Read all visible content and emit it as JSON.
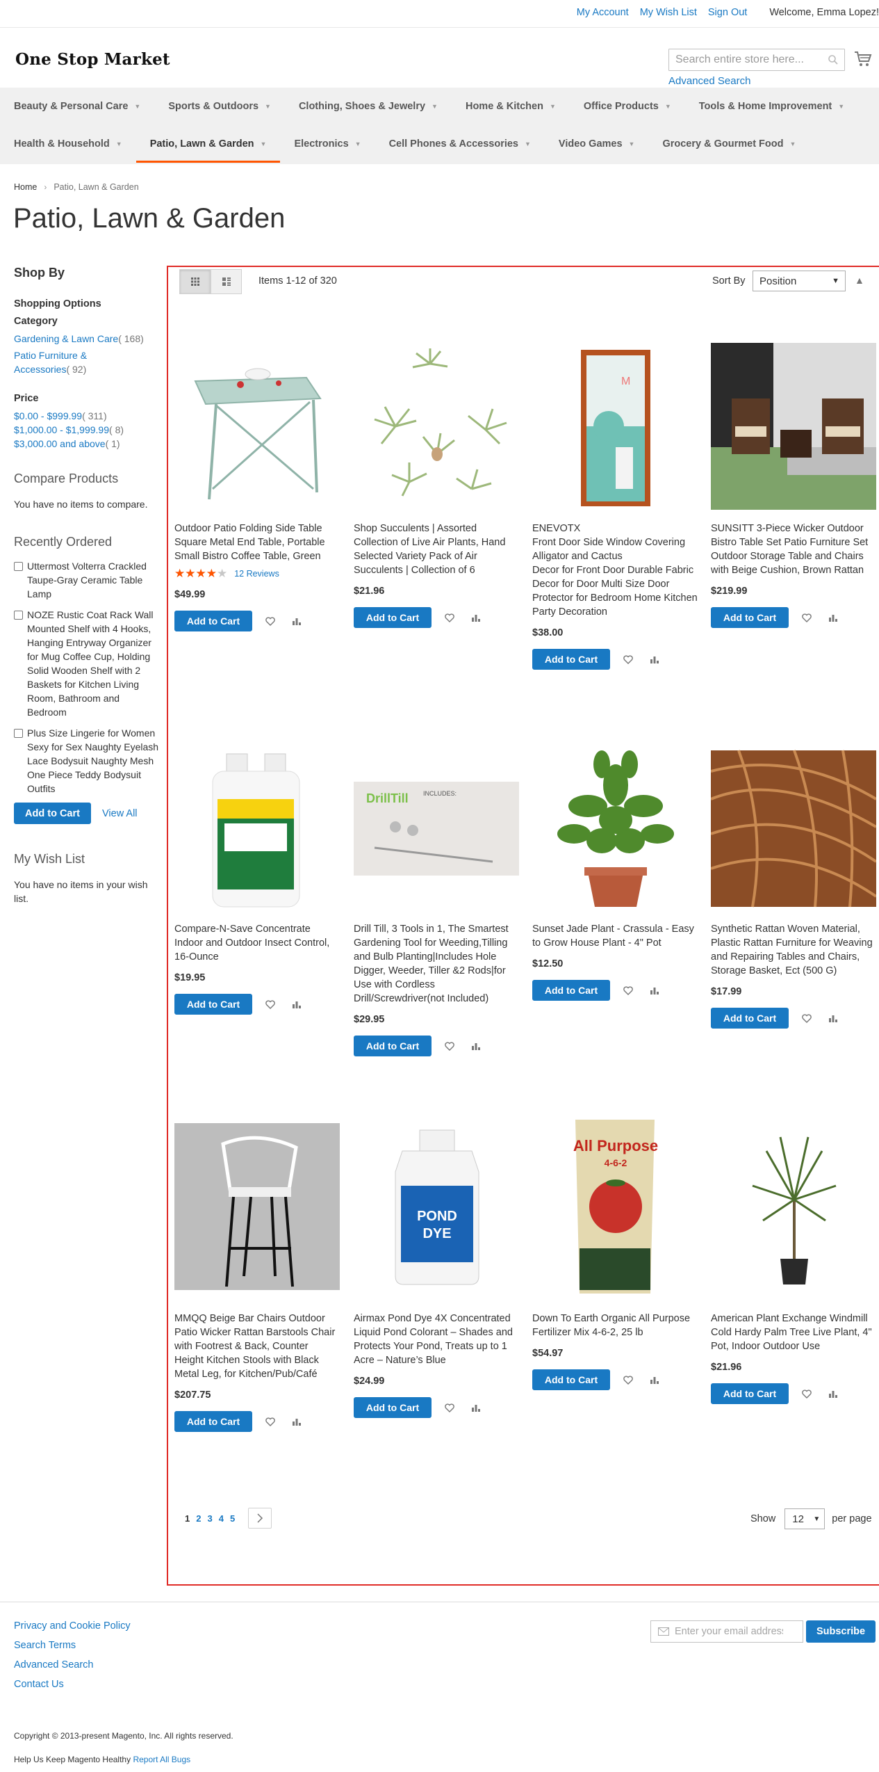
{
  "header": {
    "links": [
      "My Account",
      "My Wish List",
      "Sign Out"
    ],
    "welcome": "Welcome, Emma Lopez!",
    "logo": "One Stop Market",
    "search_placeholder": "Search entire store here...",
    "advanced_search": "Advanced Search"
  },
  "nav": {
    "row1": [
      "Beauty & Personal Care",
      "Sports & Outdoors",
      "Clothing, Shoes & Jewelry",
      "Home & Kitchen",
      "Office Products",
      "Tools & Home Improvement"
    ],
    "row2": [
      "Health & Household",
      "Patio, Lawn & Garden",
      "Electronics",
      "Cell Phones & Accessories",
      "Video Games",
      "Grocery & Gourmet Food"
    ],
    "active": "Patio, Lawn & Garden"
  },
  "breadcrumb": {
    "home": "Home",
    "current": "Patio, Lawn & Garden"
  },
  "page_title": "Patio, Lawn & Garden",
  "sidebar": {
    "shop_by": "Shop By",
    "shopping_options": "Shopping Options",
    "category_title": "Category",
    "categories": [
      {
        "label": "Gardening & Lawn Care",
        "count": "( 168)"
      },
      {
        "label": "Patio Furniture & Accessories",
        "count": "( 92)"
      }
    ],
    "price_title": "Price",
    "prices": [
      {
        "label": "$0.00 - $999.99",
        "count": "( 311)"
      },
      {
        "label": "$1,000.00 - $1,999.99",
        "count": "( 8)"
      },
      {
        "label": "$3,000.00 and above",
        "count": "( 1)"
      }
    ],
    "compare_title": "Compare Products",
    "compare_text": "You have no items to compare.",
    "recent_title": "Recently Ordered",
    "recent_items": [
      "Uttermost Volterra Crackled Taupe-Gray Ceramic Table Lamp",
      "NOZE Rustic Coat Rack Wall Mounted Shelf with 4 Hooks, Hanging Entryway Organizer for Mug Coffee Cup, Holding Solid Wooden Shelf with 2 Baskets for Kitchen Living Room, Bathroom and Bedroom",
      "Plus Size Lingerie for Women Sexy for Sex Naughty Eyelash Lace Bodysuit Naughty Mesh One Piece Teddy Bodysuit Outfits"
    ],
    "add_to_cart": "Add to Cart",
    "view_all": "View All",
    "wishlist_title": "My Wish List",
    "wishlist_text": "You have no items in your wish list."
  },
  "toolbar": {
    "amount": "Items 1-12 of 320",
    "sort_by": "Sort By",
    "sort_value": "Position"
  },
  "products": [
    {
      "name": "Outdoor Patio Folding Side Table Square Metal End Table, Portable Small Bistro Coffee Table, Green",
      "price": "$49.99",
      "rating": 0.8,
      "reviews": "12  Reviews"
    },
    {
      "name": "Shop Succulents | Assorted Collection of Live Air Plants, Hand Selected Variety Pack of Air Succulents | Collection of 6",
      "price": "$21.96"
    },
    {
      "name": "ENEVOTX\nFront Door Side Window Covering Alligator and Cactus\nDecor for Front Door Durable Fabric Decor for Door Multi Size Door Protector for Bedroom Home Kitchen Party Decoration",
      "price": "$38.00"
    },
    {
      "name": "SUNSITT 3-Piece Wicker Outdoor Bistro Table Set Patio Furniture Set Outdoor Storage Table and Chairs with Beige Cushion, Brown Rattan",
      "price": "$219.99"
    },
    {
      "name": "Compare-N-Save Concentrate Indoor and Outdoor Insect Control, 16-Ounce",
      "price": "$19.95"
    },
    {
      "name": "Drill Till, 3 Tools in 1, The Smartest Gardening Tool for Weeding,Tilling and Bulb Planting|Includes Hole Digger, Weeder, Tiller &2 Rods|for Use with Cordless Drill/Screwdriver(not Included)",
      "price": "$29.95"
    },
    {
      "name": "Sunset Jade Plant - Crassula - Easy to Grow House Plant - 4\" Pot",
      "price": "$12.50"
    },
    {
      "name": "Synthetic Rattan Woven Material, Plastic Rattan Furniture for Weaving and Repairing Tables and Chairs, Storage Basket, Ect (500 G)",
      "price": "$17.99"
    },
    {
      "name": "MMQQ Beige Bar Chairs Outdoor Patio Wicker Rattan Barstools Chair with Footrest & Back, Counter Height Kitchen Stools with Black Metal Leg, for Kitchen/Pub/Café",
      "price": "$207.75"
    },
    {
      "name": "Airmax Pond Dye 4X Concentrated Liquid Pond Colorant – Shades and Protects Your Pond, Treats up to 1 Acre – Nature’s Blue",
      "price": "$24.99"
    },
    {
      "name": "Down To Earth Organic All Purpose Fertilizer Mix 4-6-2, 25 lb",
      "price": "$54.97"
    },
    {
      "name": "American Plant Exchange Windmill Cold Hardy Palm Tree Live Plant, 4\" Pot, Indoor Outdoor Use",
      "price": "$21.96"
    }
  ],
  "product_button": "Add to Cart",
  "pager": {
    "pages": [
      "1",
      "2",
      "3",
      "4",
      "5"
    ],
    "show": "Show",
    "limit": "12",
    "per_page": "per page"
  },
  "footer": {
    "links": [
      "Privacy and Cookie Policy",
      "Search Terms",
      "Advanced Search",
      "Contact Us"
    ],
    "email_placeholder": "Enter your email address",
    "subscribe": "Subscribe",
    "copyright": "Copyright © 2013-present Magento, Inc. All rights reserved.",
    "report_prefix": "Help Us Keep Magento Healthy",
    "report_link": "Report All Bugs"
  },
  "colors": {
    "accent": "#1979c3",
    "active_nav": "#ff5501",
    "highlight_box": "#e02b27"
  }
}
